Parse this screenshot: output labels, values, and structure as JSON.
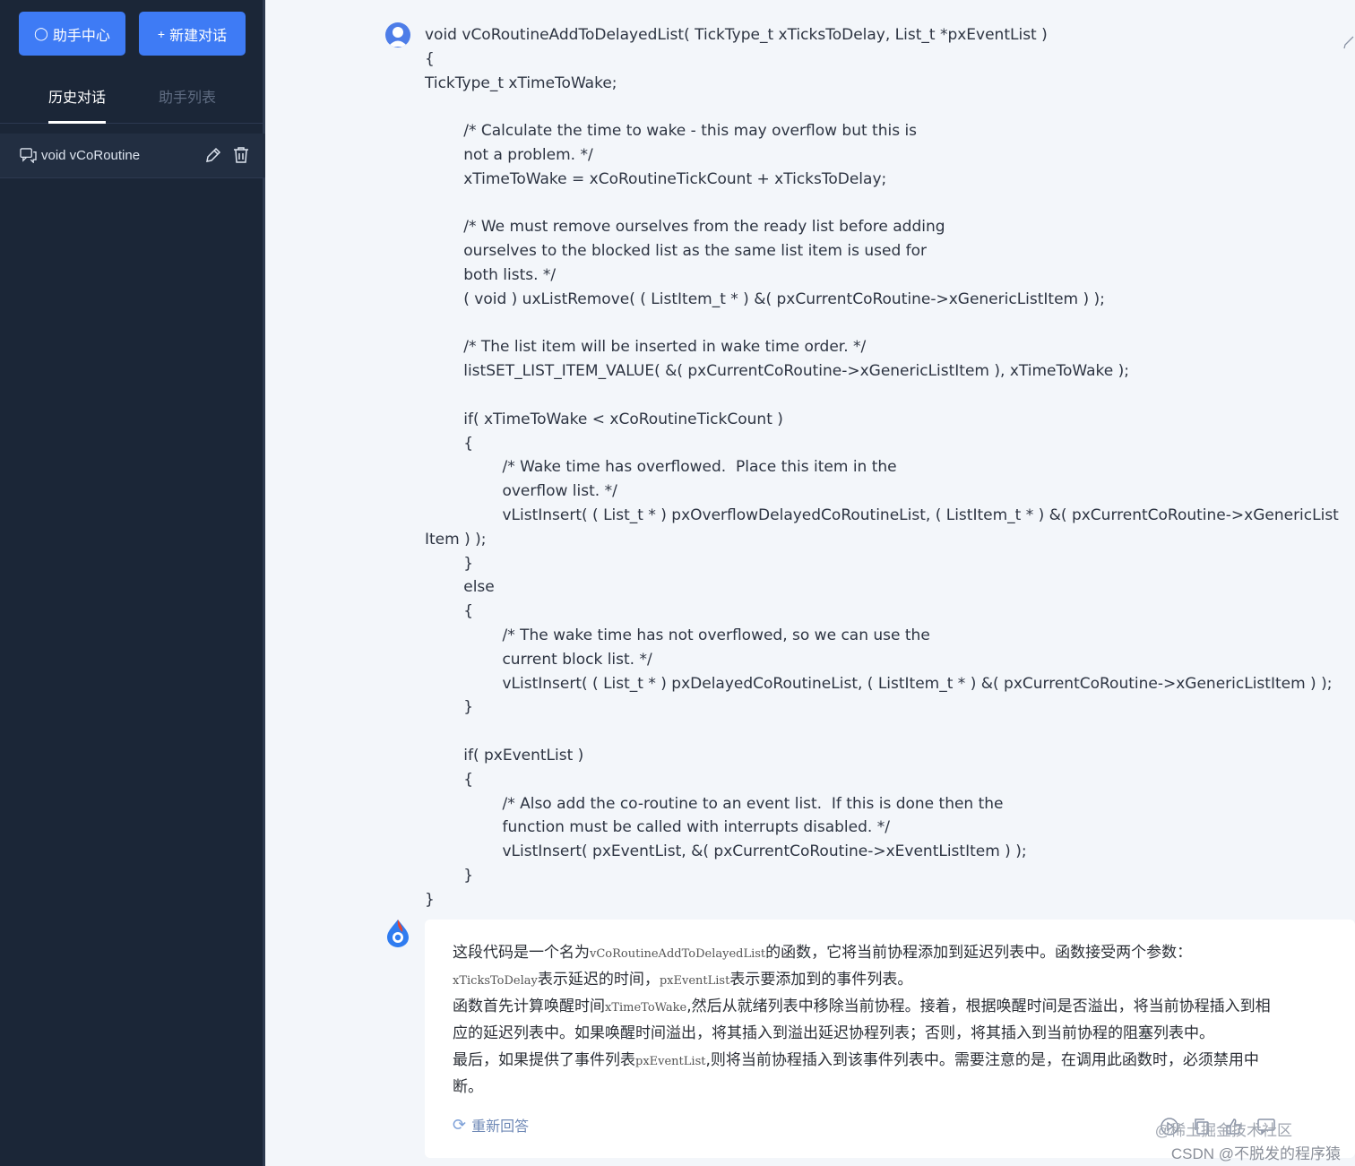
{
  "sidebar": {
    "help_button": "助手中心",
    "new_button": "新建对话",
    "tabs": {
      "history": "历史对话",
      "list": "助手列表"
    },
    "history_item": "void vCoRoutine"
  },
  "code_lines": [
    "void vCoRoutineAddToDelayedList( TickType_t xTicksToDelay, List_t *pxEventList )",
    "{",
    "TickType_t xTimeToWake;",
    "",
    "        /* Calculate the time to wake - this may overflow but this is",
    "        not a problem. */",
    "        xTimeToWake = xCoRoutineTickCount + xTicksToDelay;",
    "",
    "        /* We must remove ourselves from the ready list before adding",
    "        ourselves to the blocked list as the same list item is used for",
    "        both lists. */",
    "        ( void ) uxListRemove( ( ListItem_t * ) &( pxCurrentCoRoutine->xGenericListItem ) );",
    "",
    "        /* The list item will be inserted in wake time order. */",
    "        listSET_LIST_ITEM_VALUE( &( pxCurrentCoRoutine->xGenericListItem ), xTimeToWake );",
    "",
    "        if( xTimeToWake < xCoRoutineTickCount )",
    "        {",
    "                /* Wake time has overflowed.  Place this item in the",
    "                overflow list. */",
    "                vListInsert( ( List_t * ) pxOverflowDelayedCoRoutineList, ( ListItem_t * ) &( pxCurrentCoRoutine->xGenericList",
    "Item ) );",
    "        }",
    "        else",
    "        {",
    "                /* The wake time has not overflowed, so we can use the",
    "                current block list. */",
    "                vListInsert( ( List_t * ) pxDelayedCoRoutineList, ( ListItem_t * ) &( pxCurrentCoRoutine->xGenericListItem ) );",
    "        }",
    "",
    "        if( pxEventList )",
    "        {",
    "                /* Also add the co-routine to an event list.  If this is done then the",
    "                function must be called with interrupts disabled. */",
    "                vListInsert( pxEventList, &( pxCurrentCoRoutine->xEventListItem ) );",
    "        }",
    "}"
  ],
  "answer": {
    "p1a": "这段代码是一个名为",
    "p1code": "vCoRoutineAddToDelayedList",
    "p1b": "的函数，它将当前协程添加到延迟列表中。函数接受两个参数：",
    "p2code1": "xTicksToDelay",
    "p2a": "表示延迟的时间，",
    "p2code2": "pxEventList",
    "p2b": "表示要添加到的事件列表。",
    "p3a": "函数首先计算唤醒时间",
    "p3code": "xTimeToWake",
    "p3b": ",然后从就绪列表中移除当前协程。接着，根据唤醒时间是否溢出，将当前协程插入到相",
    "p4": "应的延迟列表中。如果唤醒时间溢出，将其插入到溢出延迟协程列表；否则，将其插入到当前协程的阻塞列表中。",
    "p5a": "最后，如果提供了事件列表",
    "p5code": "pxEventList",
    "p5b": ",则将当前协程插入到该事件列表中。需要注意的是，在调用此函数时，必须禁用中",
    "p6": "断。",
    "regenerate": "重新回答"
  },
  "watermark": {
    "line1": "@稀土掘金技术社区",
    "line2": "CSDN @不脱发的程序猿"
  },
  "icons": [
    "drop-icon",
    "plus-icon",
    "chat-icon",
    "edit-icon",
    "trash-icon",
    "user-avatar-icon",
    "ai-logo-icon",
    "refresh-icon",
    "play-icon",
    "copy-icon",
    "thumb-up-icon",
    "comment-icon"
  ]
}
